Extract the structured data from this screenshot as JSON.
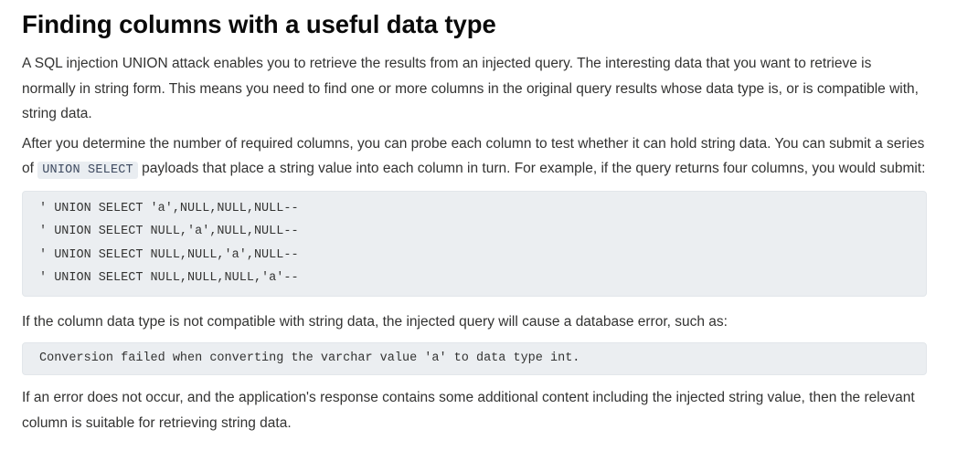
{
  "heading": "Finding columns with a useful data type",
  "paragraphs": {
    "p1": "A SQL injection UNION attack enables you to retrieve the results from an injected query. The interesting data that you want to retrieve is normally in string form. This means you need to find one or more columns in the original query results whose data type is, or is compatible with, string data.",
    "p2_before": "After you determine the number of required columns, you can probe each column to test whether it can hold string data. You can submit a series of ",
    "p2_code": "UNION SELECT",
    "p2_after": " payloads that place a string value into each column in turn. For example, if the query returns four columns, you would submit:",
    "p3": "If the column data type is not compatible with string data, the injected query will cause a database error, such as:",
    "p4": "If an error does not occur, and the application's response contains some additional content including the injected string value, then the relevant column is suitable for retrieving string data."
  },
  "payload_lines": [
    "' UNION SELECT 'a',NULL,NULL,NULL--",
    "' UNION SELECT NULL,'a',NULL,NULL--",
    "' UNION SELECT NULL,NULL,'a',NULL--",
    "' UNION SELECT NULL,NULL,NULL,'a'--"
  ],
  "error_message": "Conversion failed when converting the varchar value 'a' to data type int."
}
